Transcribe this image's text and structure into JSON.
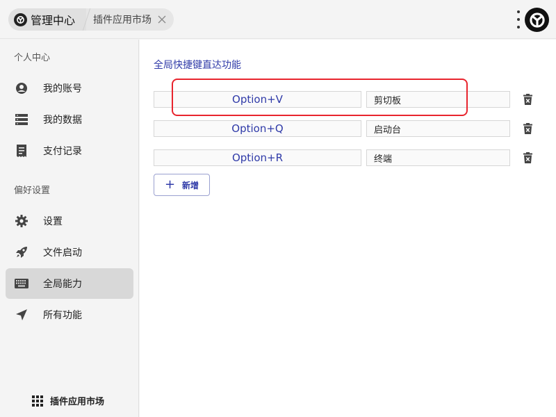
{
  "tabs": [
    {
      "label": "管理中心"
    },
    {
      "label": "插件应用市场"
    }
  ],
  "sidebar": {
    "sections": [
      {
        "title": "个人中心",
        "items": [
          {
            "label": "我的账号",
            "icon": "account-circle-icon"
          },
          {
            "label": "我的数据",
            "icon": "data-storage-icon"
          },
          {
            "label": "支付记录",
            "icon": "receipt-icon"
          }
        ]
      },
      {
        "title": "偏好设置",
        "items": [
          {
            "label": "设置",
            "icon": "gear-icon"
          },
          {
            "label": "文件启动",
            "icon": "rocket-icon"
          },
          {
            "label": "全局能力",
            "icon": "keyboard-icon",
            "active": true
          },
          {
            "label": "所有功能",
            "icon": "send-arrow-icon"
          }
        ]
      }
    ],
    "market_link": "插件应用市场"
  },
  "main": {
    "title": "全局快捷键直达功能",
    "shortcuts": [
      {
        "key": "Option+V",
        "function": "剪切板"
      },
      {
        "key": "Option+Q",
        "function": "启动台"
      },
      {
        "key": "Option+R",
        "function": "终端"
      }
    ],
    "add_label": "新增"
  },
  "colors": {
    "accent": "#2f3aa8",
    "highlight": "#e8242d",
    "active_nav": "#d8d8d8"
  }
}
